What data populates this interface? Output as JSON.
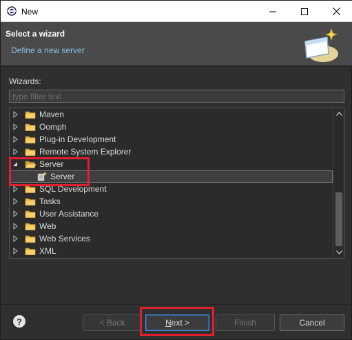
{
  "window": {
    "title": "New",
    "controls": {
      "minimize": "minimize",
      "maximize": "maximize",
      "close": "close"
    }
  },
  "banner": {
    "title": "Select a wizard",
    "description": "Define a new server"
  },
  "wizards": {
    "label": "Wizards:",
    "filter_placeholder": "type filter text",
    "filter_value": ""
  },
  "tree": {
    "items": [
      {
        "label": "Maven",
        "expanded": false,
        "level": 0,
        "icon": "folder-icon"
      },
      {
        "label": "Oomph",
        "expanded": false,
        "level": 0,
        "icon": "folder-icon"
      },
      {
        "label": "Plug-in Development",
        "expanded": false,
        "level": 0,
        "icon": "folder-icon"
      },
      {
        "label": "Remote System Explorer",
        "expanded": false,
        "level": 0,
        "icon": "folder-icon"
      },
      {
        "label": "Server",
        "expanded": true,
        "level": 0,
        "icon": "folder-open-icon"
      },
      {
        "label": "Server",
        "level": 1,
        "icon": "server-wizard-icon",
        "selected": true
      },
      {
        "label": "SQL Development",
        "expanded": false,
        "level": 0,
        "icon": "folder-icon"
      },
      {
        "label": "Tasks",
        "expanded": false,
        "level": 0,
        "icon": "folder-icon"
      },
      {
        "label": "User Assistance",
        "expanded": false,
        "level": 0,
        "icon": "folder-icon"
      },
      {
        "label": "Web",
        "expanded": false,
        "level": 0,
        "icon": "folder-icon"
      },
      {
        "label": "Web Services",
        "expanded": false,
        "level": 0,
        "icon": "folder-icon"
      },
      {
        "label": "XML",
        "expanded": false,
        "level": 0,
        "icon": "folder-icon"
      }
    ]
  },
  "buttons": {
    "help": "?",
    "back": "< Back",
    "next_prefix": "",
    "next_mnemonic": "N",
    "next_suffix": "ext >",
    "finish": "Finish",
    "cancel": "Cancel"
  },
  "colors": {
    "highlight": "#e0202e",
    "background": "#2f2f2f",
    "banner": "#4a4a4a",
    "link_text": "#8cc3e8"
  }
}
